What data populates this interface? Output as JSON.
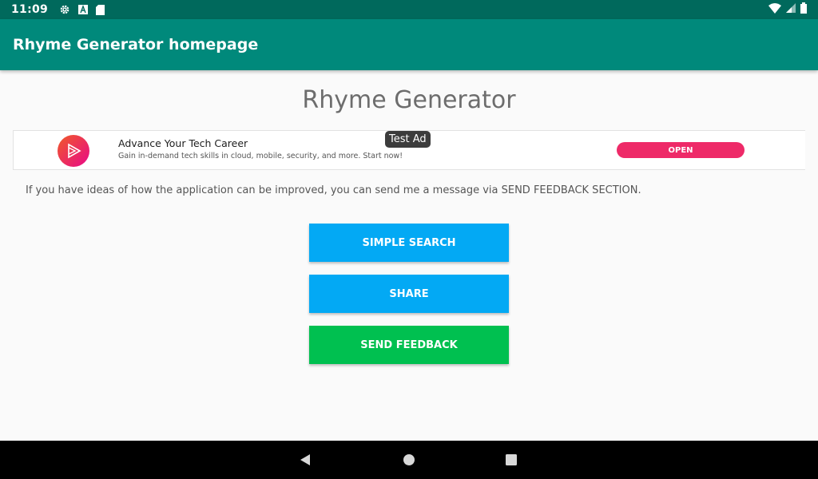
{
  "status_bar": {
    "time": "11:09",
    "left_icons": [
      "gear-icon",
      "font-a-icon",
      "sd-card-icon"
    ],
    "right_icons": [
      "wifi-icon",
      "cell-signal-icon",
      "battery-icon"
    ]
  },
  "app_bar": {
    "title": "Rhyme Generator homepage",
    "color": "#00897b"
  },
  "main": {
    "heading": "Rhyme Generator",
    "info_text": "If you have ideas of how the application can be improved, you can send me a message via SEND FEEDBACK SECTION."
  },
  "ad": {
    "badge": "Test Ad",
    "headline": "Advance Your Tech Career",
    "body": "Gain in-demand tech skills in cloud, mobile, security, and more. Start now!",
    "cta": "OPEN",
    "logo_icon": "play-logo-icon",
    "cta_color": "#ee2a68"
  },
  "buttons": {
    "simple_search": "SIMPLE SEARCH",
    "share": "SHARE",
    "send_feedback": "SEND FEEDBACK",
    "primary_color": "#03a9f4",
    "feedback_color": "#00c050"
  },
  "nav_bar": {
    "icons": [
      "back-icon",
      "home-icon",
      "recents-icon"
    ]
  }
}
